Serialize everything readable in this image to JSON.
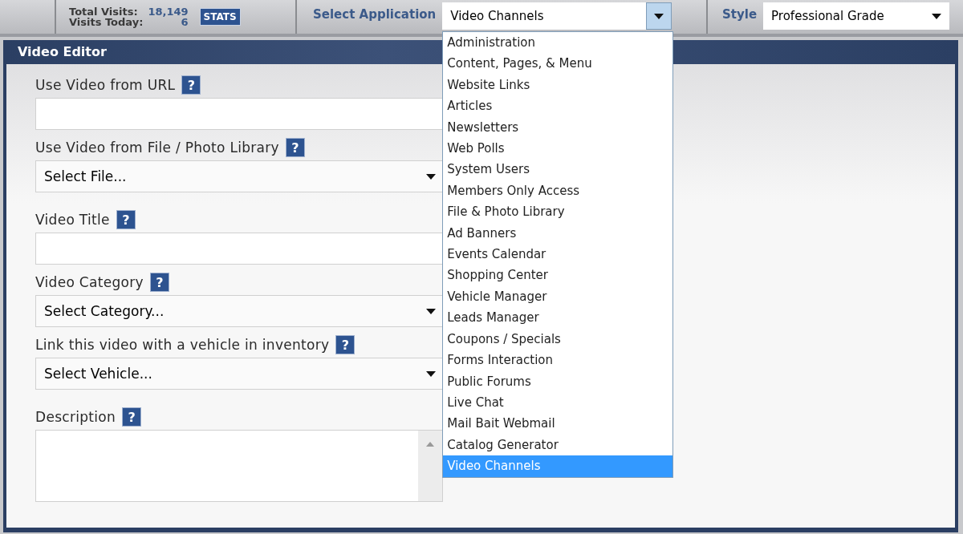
{
  "top_bar": {
    "stats": [
      {
        "label": "Total Visits:",
        "value": "18,149"
      },
      {
        "label": "Visits Today:",
        "value": "6"
      }
    ],
    "stats_button": "STATS",
    "app_label": "Select Application",
    "app_select": {
      "value": "Video Channels",
      "expanded": true,
      "options": [
        {
          "label": "Administration",
          "selected": false
        },
        {
          "label": "Content, Pages, & Menu",
          "selected": false
        },
        {
          "label": "Website Links",
          "selected": false
        },
        {
          "label": "Articles",
          "selected": false
        },
        {
          "label": "Newsletters",
          "selected": false
        },
        {
          "label": "Web Polls",
          "selected": false
        },
        {
          "label": "System Users",
          "selected": false
        },
        {
          "label": "Members Only Access",
          "selected": false
        },
        {
          "label": "File & Photo Library",
          "selected": false
        },
        {
          "label": "Ad Banners",
          "selected": false
        },
        {
          "label": "Events Calendar",
          "selected": false
        },
        {
          "label": "Shopping Center",
          "selected": false
        },
        {
          "label": "Vehicle Manager",
          "selected": false
        },
        {
          "label": "Leads Manager",
          "selected": false
        },
        {
          "label": "Coupons / Specials",
          "selected": false
        },
        {
          "label": "Forms Interaction",
          "selected": false
        },
        {
          "label": "Public Forums",
          "selected": false
        },
        {
          "label": "Live Chat",
          "selected": false
        },
        {
          "label": "Mail Bait Webmail",
          "selected": false
        },
        {
          "label": "Catalog Generator",
          "selected": false
        },
        {
          "label": "Video Channels",
          "selected": true
        }
      ]
    },
    "style_label": "Style",
    "style_select": {
      "value": "Professional Grade"
    }
  },
  "panel": {
    "title": "Video Editor",
    "fields": [
      {
        "kind": "text",
        "label": "Use Video from URL",
        "help": "?"
      },
      {
        "kind": "select",
        "label": "Use Video from File / Photo Library",
        "help": "?",
        "value": "Select File..."
      },
      {
        "kind": "text",
        "label": "Video Title",
        "help": "?"
      },
      {
        "kind": "select",
        "label": "Video Category",
        "help": "?",
        "value": "Select Category..."
      },
      {
        "kind": "select",
        "label": "Link this video with a vehicle in inventory",
        "help": "?",
        "value": "Select Vehicle..."
      },
      {
        "kind": "textarea",
        "label": "Description",
        "help": "?"
      }
    ]
  }
}
